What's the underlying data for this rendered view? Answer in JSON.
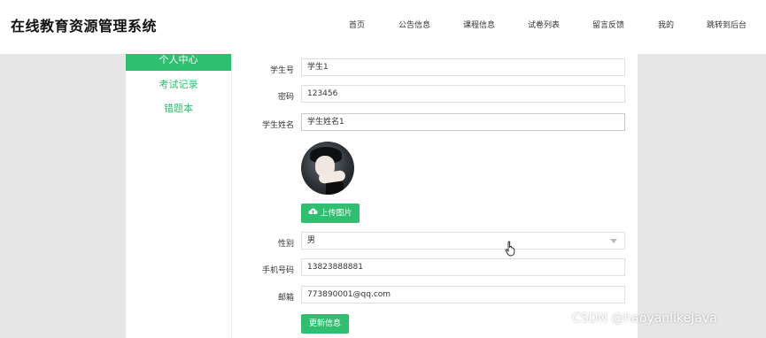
{
  "brand": "在线教育资源管理系统",
  "nav": [
    "首页",
    "公告信息",
    "课程信息",
    "试卷列表",
    "留言反馈",
    "我的",
    "跳转到后台"
  ],
  "sidebar": {
    "items": [
      "个人中心",
      "考试记录",
      "错题本"
    ],
    "active": 0
  },
  "form": {
    "student_no": {
      "label": "学生号",
      "value": "学生1"
    },
    "password": {
      "label": "密码",
      "value": "123456"
    },
    "student_name": {
      "label": "学生姓名",
      "value": "学生姓名1"
    },
    "upload_label": "上传图片",
    "gender": {
      "label": "性别",
      "value": "男"
    },
    "phone": {
      "label": "手机号码",
      "value": "13823888881"
    },
    "email": {
      "label": "邮箱",
      "value": "773890001@qq.com"
    },
    "submit_label": "更新信息"
  },
  "watermark": "CSDN @haoyanlikeJava",
  "colors": {
    "accent": "#2fbf71",
    "background": "#e6e6e6"
  },
  "icons": {
    "upload": "cloud-upload-icon",
    "cursor": "hand-pointer-icon",
    "select": "chevron-down-icon"
  }
}
